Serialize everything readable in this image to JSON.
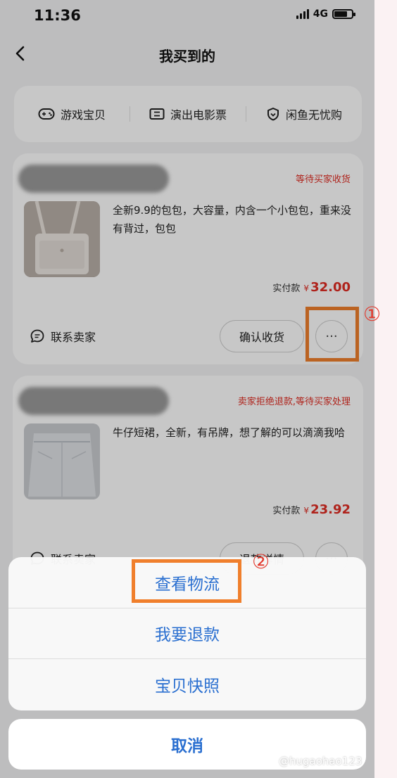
{
  "status_bar": {
    "time": "11:36",
    "network": "4G"
  },
  "nav": {
    "title": "我买到的"
  },
  "categories": [
    {
      "label": "游戏宝贝",
      "icon": "gamepad-icon"
    },
    {
      "label": "演出电影票",
      "icon": "ticket-icon"
    },
    {
      "label": "闲鱼无忧购",
      "icon": "shield-heart-icon"
    }
  ],
  "orders": [
    {
      "status": "等待买家收货",
      "description": "全新9.9的包包，大容量，内含一个小包包，重来没有背过，包包",
      "price_label": "实付款",
      "price_symbol": "¥",
      "price": "32.00",
      "contact_label": "联系卖家",
      "primary_action": "确认收货",
      "more_label": "···"
    },
    {
      "status": "卖家拒绝退款,等待买家处理",
      "description": "牛仔短裙，全新，有吊牌，想了解的可以滴滴我哈",
      "price_label": "实付款",
      "price_symbol": "¥",
      "price": "23.92",
      "contact_label": "联系卖家",
      "primary_action": "退款详情",
      "more_label": "···"
    }
  ],
  "annotations": {
    "step1": "①",
    "step2": "②"
  },
  "action_sheet": {
    "items": [
      "查看物流",
      "我要退款",
      "宝贝快照"
    ],
    "cancel": "取消"
  },
  "watermark": "@hugaohao123",
  "colors": {
    "accent_red": "#e02e24",
    "sheet_blue": "#2a6fd0",
    "highlight_orange": "#f07f2c"
  }
}
